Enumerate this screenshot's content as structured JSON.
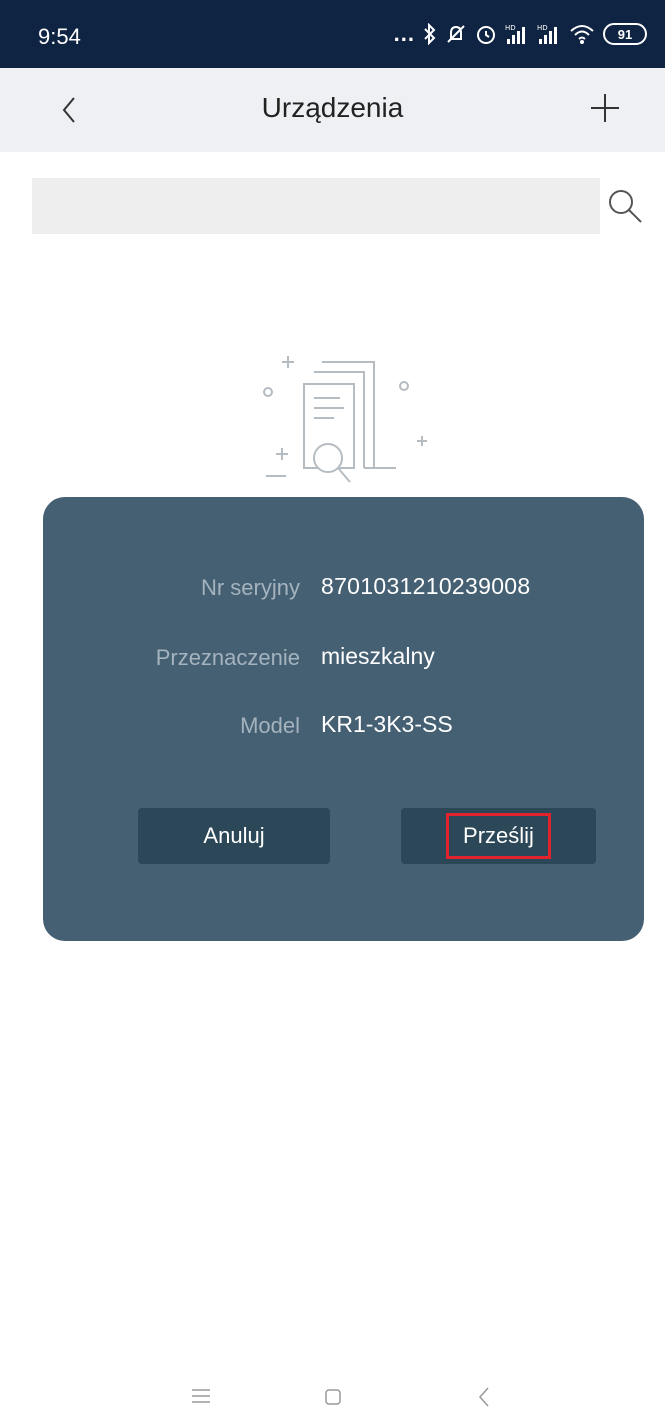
{
  "status_bar": {
    "time": "9:54",
    "dots": "...",
    "battery": "91",
    "icons": [
      "bluetooth-icon",
      "mute-icon",
      "alarm-icon",
      "signal-hd-icon",
      "signal-hd-icon",
      "wifi-icon",
      "battery-icon"
    ]
  },
  "header": {
    "title": "Urządzenia",
    "back_icon": "chevron-left-icon",
    "add_icon": "plus-icon"
  },
  "search": {
    "value": "",
    "placeholder": "",
    "icon": "search-icon"
  },
  "empty_state": {
    "icon": "document-search-icon"
  },
  "dialog": {
    "serial_label": "Nr seryjny",
    "serial_value": "8701031210239008",
    "purpose_label": "Przeznaczenie",
    "purpose_value": "mieszkalny",
    "model_label": "Model",
    "model_value": "KR1-3K3-SS",
    "cancel_label": "Anuluj",
    "submit_label": "Prześlij",
    "highlight_color": "#e0232c"
  },
  "nav_bar": {
    "icons": [
      "menu-icon",
      "home-icon",
      "back-icon"
    ]
  },
  "colors": {
    "status_bar": "#0f2342",
    "header": "#eef0f3",
    "dialog": "#456073",
    "button": "#2c4757"
  }
}
